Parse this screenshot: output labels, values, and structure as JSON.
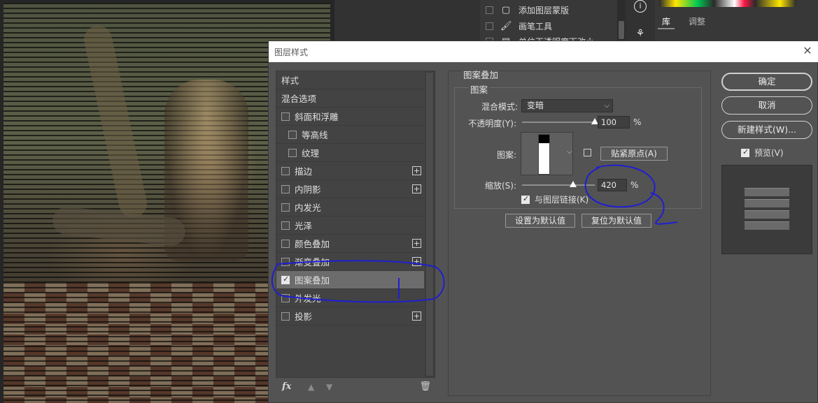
{
  "history": {
    "items": [
      {
        "label": "添加图层蒙版",
        "icon": "layer-mask-icon"
      },
      {
        "label": "画笔工具",
        "icon": "brush-icon"
      },
      {
        "label": "单位下透明度下改小",
        "icon": "layer-icon"
      }
    ]
  },
  "right_panel": {
    "tabs": [
      "库",
      "调整"
    ]
  },
  "dialog": {
    "title": "图层样式",
    "close_symbol": "✕",
    "style_list": {
      "header": "样式",
      "blend_options": "混合选项",
      "items": [
        {
          "label": "斜面和浮雕",
          "checked": false,
          "indent": false,
          "plus": false
        },
        {
          "label": "等高线",
          "checked": false,
          "indent": true,
          "plus": false
        },
        {
          "label": "纹理",
          "checked": false,
          "indent": true,
          "plus": false
        },
        {
          "label": "描边",
          "checked": false,
          "indent": false,
          "plus": true
        },
        {
          "label": "内阴影",
          "checked": false,
          "indent": false,
          "plus": true
        },
        {
          "label": "内发光",
          "checked": false,
          "indent": false,
          "plus": false
        },
        {
          "label": "光泽",
          "checked": false,
          "indent": false,
          "plus": false
        },
        {
          "label": "颜色叠加",
          "checked": false,
          "indent": false,
          "plus": true
        },
        {
          "label": "渐变叠加",
          "checked": false,
          "indent": false,
          "plus": true
        },
        {
          "label": "图案叠加",
          "checked": true,
          "indent": false,
          "plus": false,
          "selected": true
        },
        {
          "label": "外发光",
          "checked": false,
          "indent": false,
          "plus": false
        },
        {
          "label": "投影",
          "checked": false,
          "indent": false,
          "plus": true
        }
      ]
    },
    "fx_label": "fx",
    "pattern_overlay": {
      "group_title": "图案叠加",
      "sub_title": "图案",
      "blend_mode_label": "混合模式:",
      "blend_mode_value": "变暗",
      "opacity_label": "不透明度(Y):",
      "opacity_value": "100",
      "opacity_unit": "%",
      "opacity_fraction": 1.0,
      "pattern_label": "图案:",
      "snap_origin_label": "贴紧原点(A)",
      "scale_label": "缩放(S):",
      "scale_value": "420",
      "scale_unit": "%",
      "scale_fraction": 0.7,
      "link_label": "与图层链接(K)",
      "link_checked": true,
      "set_default_label": "设置为默认值",
      "reset_default_label": "复位为默认值"
    },
    "buttons": {
      "ok": "确定",
      "cancel": "取消",
      "new_style": "新建样式(W)...",
      "preview": "预览(V)",
      "preview_checked": true
    }
  },
  "colors": {
    "dialog_bg": "#535353",
    "annotation": "#1f1fd0"
  }
}
